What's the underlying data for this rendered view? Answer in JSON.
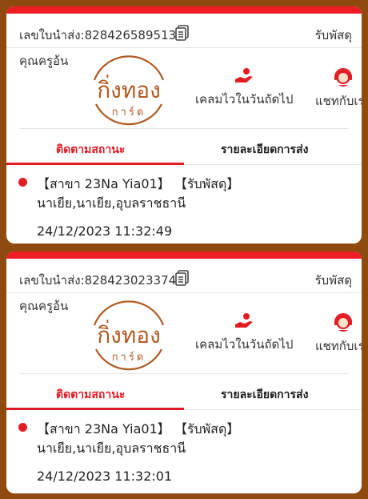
{
  "colors": {
    "accent": "#e31b23",
    "background": "#8f4a0f",
    "logo": "#b05a23"
  },
  "cards": [
    {
      "tracking_label": "เลขใบนำส่ง:828426589513",
      "status_top": "รับพัสดุ",
      "customer_name": "คุณครูอ้น",
      "logo_main": "กิ่งทอง",
      "logo_sub": "การ์ด",
      "claim_label": "เคลมไวในวันถัดไป",
      "chat_label": "แชทกับเรา",
      "tab_tracking": "ติดตามสถานะ",
      "tab_details": "รายละเอียดการส่ง",
      "event_status": "【สาขา 23Na Yia01】 【รับพัสดุ】",
      "event_location": "นาเยีย,นาเยีย,อุบลราชธานี",
      "event_time": "24/12/2023 11:32:49"
    },
    {
      "tracking_label": "เลขใบนำส่ง:828423023374",
      "status_top": "รับพัสดุ",
      "customer_name": "คุณครูอ้น",
      "logo_main": "กิ่งทอง",
      "logo_sub": "การ์ด",
      "claim_label": "เคลมไวในวันถัดไป",
      "chat_label": "แชทกับเรา",
      "tab_tracking": "ติดตามสถานะ",
      "tab_details": "รายละเอียดการส่ง",
      "event_status": "【สาขา 23Na Yia01】 【รับพัสดุ】",
      "event_location": "นาเยีย,นาเยีย,อุบลราชธานี",
      "event_time": "24/12/2023 11:32:01"
    }
  ],
  "icons": {
    "copy": "copy-icon",
    "claim": "hand-coin-icon",
    "chat": "support-agent-icon"
  }
}
